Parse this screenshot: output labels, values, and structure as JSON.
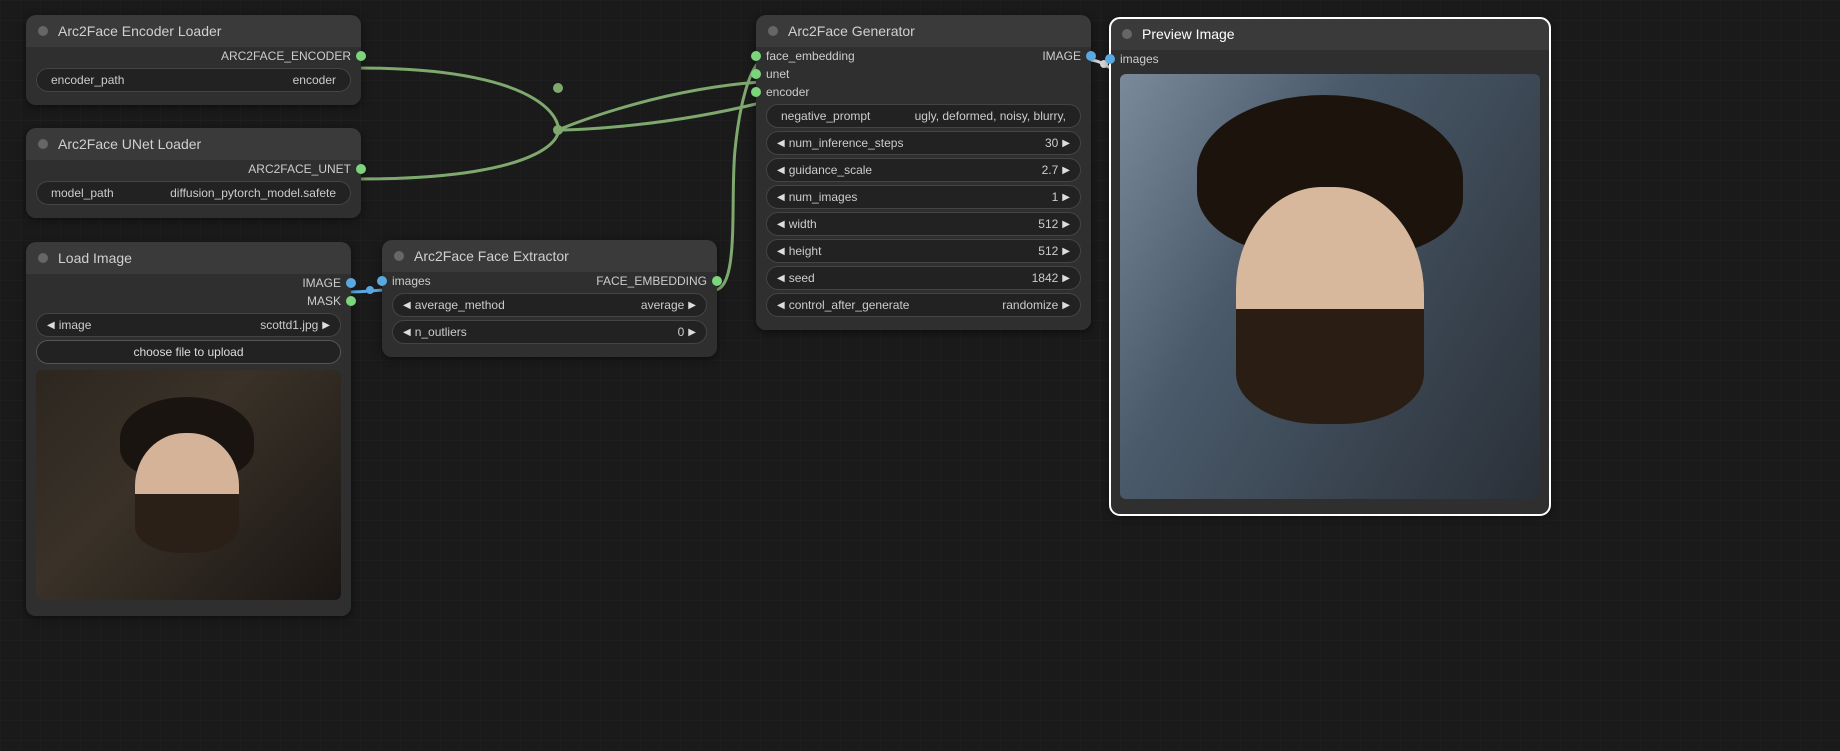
{
  "nodes": {
    "encoder_loader": {
      "title": "Arc2Face Encoder Loader",
      "out_port": "ARC2FACE_ENCODER",
      "widgets": [
        {
          "label": "encoder_path",
          "value": "encoder"
        }
      ]
    },
    "unet_loader": {
      "title": "Arc2Face UNet Loader",
      "out_port": "ARC2FACE_UNET",
      "widgets": [
        {
          "label": "model_path",
          "value": "diffusion_pytorch_model.safete"
        }
      ]
    },
    "load_image": {
      "title": "Load Image",
      "out_ports": [
        "IMAGE",
        "MASK"
      ],
      "widgets": [
        {
          "label": "image",
          "value": "scottd1.jpg"
        }
      ],
      "button": "choose file to upload"
    },
    "face_extractor": {
      "title": "Arc2Face Face Extractor",
      "in_port": "images",
      "out_port": "FACE_EMBEDDING",
      "widgets": [
        {
          "label": "average_method",
          "value": "average"
        },
        {
          "label": "n_outliers",
          "value": "0"
        }
      ]
    },
    "generator": {
      "title": "Arc2Face Generator",
      "in_ports": [
        "face_embedding",
        "unet",
        "encoder"
      ],
      "out_port": "IMAGE",
      "text_widget": {
        "label": "negative_prompt",
        "value": "ugly, deformed, noisy, blurry,"
      },
      "widgets": [
        {
          "label": "num_inference_steps",
          "value": "30"
        },
        {
          "label": "guidance_scale",
          "value": "2.7"
        },
        {
          "label": "num_images",
          "value": "1"
        },
        {
          "label": "width",
          "value": "512"
        },
        {
          "label": "height",
          "value": "512"
        },
        {
          "label": "seed",
          "value": "1842"
        },
        {
          "label": "control_after_generate",
          "value": "randomize"
        }
      ]
    },
    "preview": {
      "title": "Preview Image",
      "in_port": "images"
    }
  },
  "colors": {
    "encoder": "#7bd67b",
    "unet": "#7bd67b",
    "face_embedding": "#7bd67b",
    "image": "#5aa8e0",
    "mask": "#7bd67b"
  }
}
